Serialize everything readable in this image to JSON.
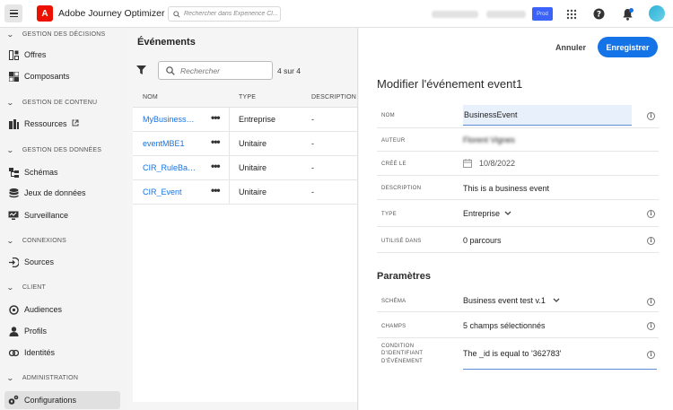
{
  "app": {
    "title": "Adobe Journey Optimizer",
    "logo_letter": "A",
    "search_placeholder": "Rechercher dans Experience Cl...",
    "env_badge": "Prod",
    "accent": "#1473e6"
  },
  "sidebar": {
    "sections": [
      {
        "label": "GESTION DES DÉCISIONS",
        "items": [
          {
            "label": "Offres",
            "icon": "offers-icon"
          },
          {
            "label": "Composants",
            "icon": "components-icon"
          }
        ]
      },
      {
        "label": "GESTION DE CONTENU",
        "items": [
          {
            "label": "Ressources",
            "icon": "assets-icon"
          }
        ]
      },
      {
        "label": "GESTION DES DONNÉES",
        "items": [
          {
            "label": "Schémas",
            "icon": "schema-icon"
          },
          {
            "label": "Jeux de données",
            "icon": "datasets-icon"
          },
          {
            "label": "Surveillance",
            "icon": "monitoring-icon"
          }
        ]
      },
      {
        "label": "CONNEXIONS",
        "items": [
          {
            "label": "Sources",
            "icon": "sources-icon"
          }
        ]
      },
      {
        "label": "CLIENT",
        "items": [
          {
            "label": "Audiences",
            "icon": "audiences-icon"
          },
          {
            "label": "Profils",
            "icon": "profiles-icon"
          },
          {
            "label": "Identités",
            "icon": "identities-icon"
          }
        ]
      },
      {
        "label": "ADMINISTRATION",
        "items": [
          {
            "label": "Configurations",
            "icon": "configurations-icon"
          }
        ]
      }
    ]
  },
  "events_panel": {
    "title": "Événements",
    "search_placeholder": "Rechercher",
    "count": "4 sur 4",
    "columns": [
      "NOM",
      "TYPE",
      "DESCRIPTION"
    ],
    "rows": [
      {
        "name": "MyBusinessE...",
        "more": "•••",
        "type": "Entreprise",
        "description": "-"
      },
      {
        "name": "eventMBE1",
        "more": "•••",
        "type": "Unitaire",
        "description": "-"
      },
      {
        "name": "CIR_RuleBased",
        "more": "•••",
        "type": "Unitaire",
        "description": "-"
      },
      {
        "name": "CIR_Event",
        "more": "•••",
        "type": "Unitaire",
        "description": "-"
      }
    ]
  },
  "editor": {
    "cancel_label": "Annuler",
    "save_label": "Enregistrer",
    "title": "Modifier l'événement event1",
    "fields": {
      "name": {
        "label": "NOM",
        "value": "BusinessEvent"
      },
      "author": {
        "label": "AUTEUR",
        "value": "Florent Vignes"
      },
      "created": {
        "label": "CRÉÉ LE",
        "value": "10/8/2022"
      },
      "description": {
        "label": "DESCRIPTION",
        "value": "This is a business event"
      },
      "type": {
        "label": "TYPE",
        "value": "Entreprise"
      },
      "used_in": {
        "label": "UTILISÉ DANS",
        "value": "0 parcours"
      }
    },
    "params_title": "Paramètres",
    "params": {
      "schema": {
        "label": "SCHÉMA",
        "value": "Business event test v.1"
      },
      "fields": {
        "label": "CHAMPS",
        "value": "5 champs sélectionnés"
      },
      "condition": {
        "label_lines": [
          "CONDITION",
          "D'IDENTIFIANT",
          "D'ÉVÉNEMENT"
        ],
        "value": "The _id is equal to '362783'"
      }
    }
  }
}
